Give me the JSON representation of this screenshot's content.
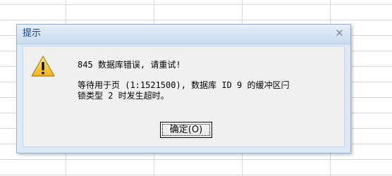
{
  "dialog": {
    "title": "提示",
    "close_symbol": "✕",
    "icon": "warning-triangle-icon",
    "message_title": "845 数据库错误, 请重试!",
    "message_detail_line1": "等待用于页 (1:1521500), 数据库 ID 9 的缓冲区闩",
    "message_detail_line2": "锁类型 2 时发生超时。",
    "ok_button_label": "确定(O)"
  },
  "colors": {
    "title_text": "#15428b",
    "dialog_frame": "#dde9f6",
    "warning_fill": "#f7c52b"
  }
}
